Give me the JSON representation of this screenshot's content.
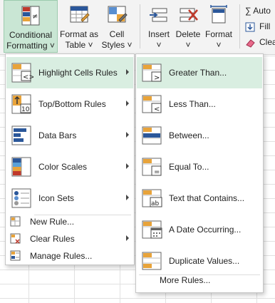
{
  "ribbon": {
    "conditional_formatting": {
      "line1": "Conditional",
      "line2": "Formatting ˅"
    },
    "format_as_table": {
      "line1": "Format as",
      "line2": "Table ˅"
    },
    "cell_styles": {
      "line1": "Cell",
      "line2": "Styles ˅"
    },
    "insert": {
      "line1": "Insert",
      "line2": "˅"
    },
    "delete": {
      "line1": "Delete",
      "line2": "˅"
    },
    "format": {
      "line1": "Format",
      "line2": "˅"
    },
    "autosum": "∑ Auto",
    "fill": "Fill",
    "clear": "Clea"
  },
  "main_menu": {
    "highlight_cells_rules": "Highlight Cells Rules",
    "top_bottom_rules": "Top/Bottom Rules",
    "data_bars": "Data Bars",
    "color_scales": "Color Scales",
    "icon_sets": "Icon Sets",
    "new_rule": "New Rule...",
    "clear_rules": "Clear Rules",
    "manage_rules": "Manage Rules..."
  },
  "sub_menu": {
    "greater_than": "Greater Than...",
    "less_than": "Less Than...",
    "between": "Between...",
    "equal_to": "Equal To...",
    "text_that_contains": "Text that Contains...",
    "a_date_occurring": "A Date Occurring...",
    "duplicate_values": "Duplicate Values...",
    "more_rules": "More Rules..."
  },
  "colors": {
    "accent_green": "#217346",
    "active_bg": "#d9eee1",
    "icon_blue": "#2b579a",
    "icon_orange": "#e8a33a",
    "icon_red": "#c0392b"
  }
}
